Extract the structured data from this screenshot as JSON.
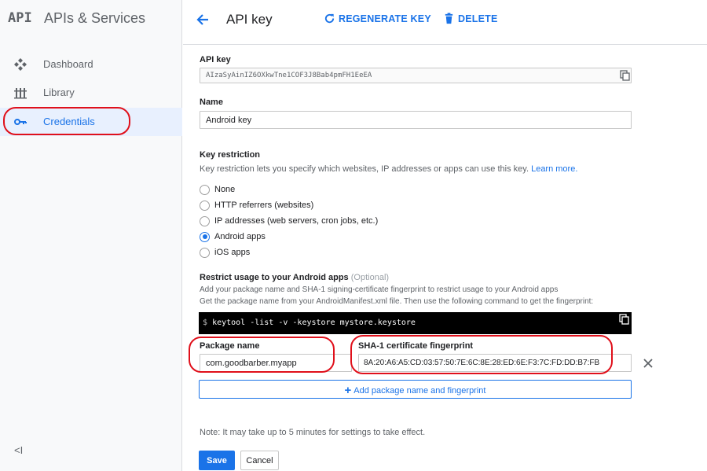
{
  "sidebar": {
    "logo": "API",
    "title": "APIs & Services",
    "items": [
      {
        "label": "Dashboard",
        "icon": "dashboard-icon"
      },
      {
        "label": "Library",
        "icon": "library-icon"
      },
      {
        "label": "Credentials",
        "icon": "key-icon",
        "active": true
      }
    ],
    "collapse": "<I"
  },
  "header": {
    "title": "API key",
    "regenerate_label": "REGENERATE KEY",
    "delete_label": "DELETE"
  },
  "form": {
    "api_key_label": "API key",
    "api_key_value": "AIzaSyAinIZ6OXkwTne1COF3J8Bab4pmFH1EeEA",
    "name_label": "Name",
    "name_value": "Android key",
    "restriction_title": "Key restriction",
    "restriction_desc": "Key restriction lets you specify which websites, IP addresses or apps can use this key.",
    "learn_more": "Learn more.",
    "options": [
      {
        "label": "None",
        "checked": false
      },
      {
        "label": "HTTP referrers (websites)",
        "checked": false
      },
      {
        "label": "IP addresses (web servers, cron jobs, etc.)",
        "checked": false
      },
      {
        "label": "Android apps",
        "checked": true
      },
      {
        "label": "iOS apps",
        "checked": false
      }
    ],
    "android_title": "Restrict usage to your Android apps",
    "android_optional": "(Optional)",
    "android_desc_1": "Add your package name and SHA-1 signing-certificate fingerprint to restrict usage to your Android apps",
    "android_desc_2": "Get the package name from your AndroidManifest.xml file. Then use the following command to get the fingerprint:",
    "command_prompt": "$",
    "command": "keytool -list -v -keystore mystore.keystore",
    "package_label": "Package name",
    "package_value": "com.goodbarber.myapp",
    "sha_label": "SHA-1 certificate fingerprint",
    "sha_value": "8A:20:A6:A5:CD:03:57:50:7E:6C:8E:28:ED:6E:F3:7C:FD:DD:B7:FB",
    "add_label": "Add package name and fingerprint",
    "note": "Note: It may take up to 5 minutes for settings to take effect.",
    "save_label": "Save",
    "cancel_label": "Cancel"
  },
  "colors": {
    "accent": "#1a73e8",
    "annotation": "#e0101b",
    "command_bg": "#000000"
  }
}
